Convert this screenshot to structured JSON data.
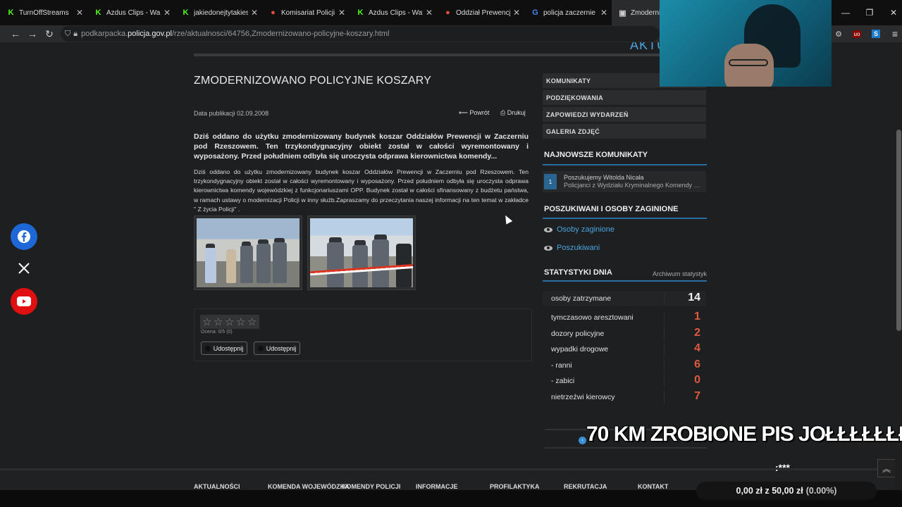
{
  "browser": {
    "tabs": [
      {
        "title": "TurnOffStreams",
        "icon": "kick-icon"
      },
      {
        "title": "Azdus Clips - Wa",
        "icon": "kick-icon"
      },
      {
        "title": "jakiedonejtytakiestri",
        "icon": "kick-icon"
      },
      {
        "title": "Komisariat Policji II w",
        "icon": "map-pin-icon"
      },
      {
        "title": "Azdus Clips - Watch",
        "icon": "kick-icon"
      },
      {
        "title": "Oddział Prewencji Po",
        "icon": "map-pin-icon"
      },
      {
        "title": "policja zaczernie - Sz",
        "icon": "google-icon"
      },
      {
        "title": "Zmoderni",
        "icon": "page-icon"
      }
    ],
    "url_prefix": "podkarpacka.",
    "url_host": "policja.gov.pl",
    "url_path": "/rze/aktualnosci/64756,Zmodernizowano-policyjne-koszary.html"
  },
  "header": {
    "section": "AKTU"
  },
  "article": {
    "title": "ZMODERNIZOWANO POLICYJNE KOSZARY",
    "pub_label": "Data publikacji",
    "pub_date": "02.09.2008",
    "back_label": "Powrót",
    "print_label": "Drukuj",
    "lead": "Dziś oddano do użytku zmodernizowany budynek koszar Oddziałów Prewencji w Zaczerniu pod Rzeszowem. Ten trzykondygnacyjny obiekt został w całości wyremontowany i wyposażony. Przed południem odbyła się uroczysta odprawa kierownictwa komendy...",
    "body": "Dziś oddano do użytku zmodernizowany budynek koszar Oddziałów Prewencji w  Zaczerniu pod Rzeszowem. Ten trzykondygnacyjny obiekt został w całości wyremontowany i wyposażony. Przed południem odbyła się uroczysta odprawa kierownictwa komendy wojewódzkiej z funkcjonariuszami OPP. Budynek został w całości sfinansowany z budżetu państwa, w ramach ustawy o modernizacji Policji w inny służb.Zapraszamy do przeczytania naszej informacji na ten temat w zakładce \" Z życia Policji\" .",
    "rating_text": "Ocena: 0/5 (0)",
    "rating_stars": 0,
    "share_labels": [
      "Udostępnij",
      "Udostępnij"
    ]
  },
  "sidebar": {
    "menu": [
      "KOMUNIKATY",
      "PODZIĘKOWANIA",
      "ZAPOWIEDZI WYDARZEŃ",
      "GALERIA ZDJĘĆ"
    ],
    "news_heading": "NAJNOWSZE KOMUNIKATY",
    "news_item": {
      "num": "1",
      "title": "Poszukujemy Witolda Nicała",
      "subtitle": "Policjanci z Wydziału Kryminalnego Komendy Miejskiej"
    },
    "missing_heading": "POSZUKIWANI I OSOBY ZAGINIONE",
    "missing_links": [
      "Osoby zaginione",
      "Poszukiwani"
    ],
    "stats_heading": "STATYSTYKI DNIA",
    "stats_archive": "Archiwum statystyk",
    "stats": [
      {
        "label": "osoby zatrzymane",
        "value": "14"
      },
      {
        "label": "tymczasowo aresztowani",
        "value": "1"
      },
      {
        "label": "dozory policyjne",
        "value": "2"
      },
      {
        "label": "wypadki drogowe",
        "value": "4"
      },
      {
        "label": "- ranni",
        "value": "6"
      },
      {
        "label": "- zabici",
        "value": "0"
      },
      {
        "label": "nietrzeźwi kierowcy",
        "value": "7"
      }
    ]
  },
  "footer": {
    "links": [
      "AKTUALNOŚCI",
      "KOMENDA WOJEWÓDZKA",
      "KOMENDY POLICJI",
      "INFORMACJE",
      "PROFILAKTYKA",
      "REKRUTACJA",
      "KONTAKT"
    ]
  },
  "stream_overlay": {
    "caption": "70 KM ZROBIONE PIS JOŁŁŁŁŁŁŁ",
    "stars": ":***",
    "donation_amount": "0,00 zł z 50,00 zł",
    "donation_percent": "(0.00%)"
  },
  "colors": {
    "accent": "#4aa3df",
    "stat_red": "#e05a3e",
    "facebook": "#1d68d6",
    "youtube": "#e01010"
  }
}
